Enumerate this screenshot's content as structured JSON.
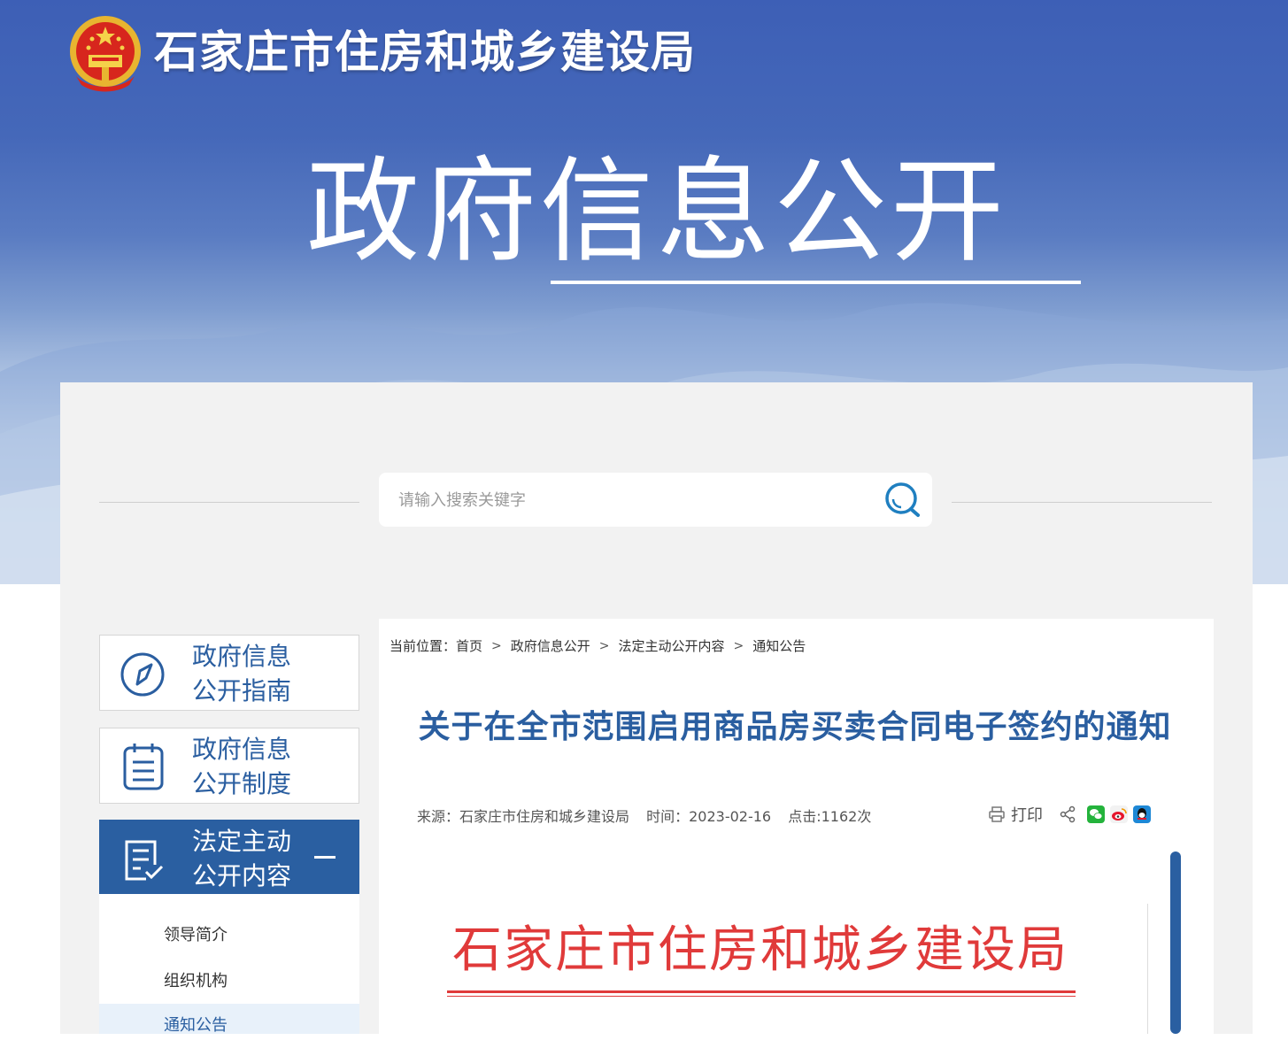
{
  "header": {
    "org_name": "石家庄市住房和城乡建设局",
    "section_title": "政府信息公开"
  },
  "search": {
    "placeholder": "请输入搜索关键字"
  },
  "sidebar": {
    "items": [
      {
        "line1": "政府信息",
        "line2": "公开指南",
        "icon": "compass-icon"
      },
      {
        "line1": "政府信息",
        "line2": "公开制度",
        "icon": "clipboard-icon"
      },
      {
        "line1": "法定主动",
        "line2": "公开内容",
        "icon": "document-check-icon",
        "expanded": true
      }
    ],
    "sub_items": [
      "领导简介",
      "组织机构",
      "通知公告"
    ]
  },
  "breadcrumb": {
    "prefix": "当前位置：",
    "items": [
      "首页",
      "政府信息公开",
      "法定主动公开内容",
      "通知公告"
    ]
  },
  "article": {
    "title": "关于在全市范围启用商品房买卖合同电子签约的通知",
    "source": "来源：石家庄市住房和城乡建设局",
    "time": "时间：2023-02-16",
    "clicks": "点击:1162次",
    "print_label": "打印"
  },
  "document": {
    "letterhead": "石家庄市住房和城乡建设局"
  },
  "colors": {
    "brand_blue": "#2a5fa1",
    "banner_blue": "#4568b9",
    "letterhead_red": "#e03a3a"
  }
}
